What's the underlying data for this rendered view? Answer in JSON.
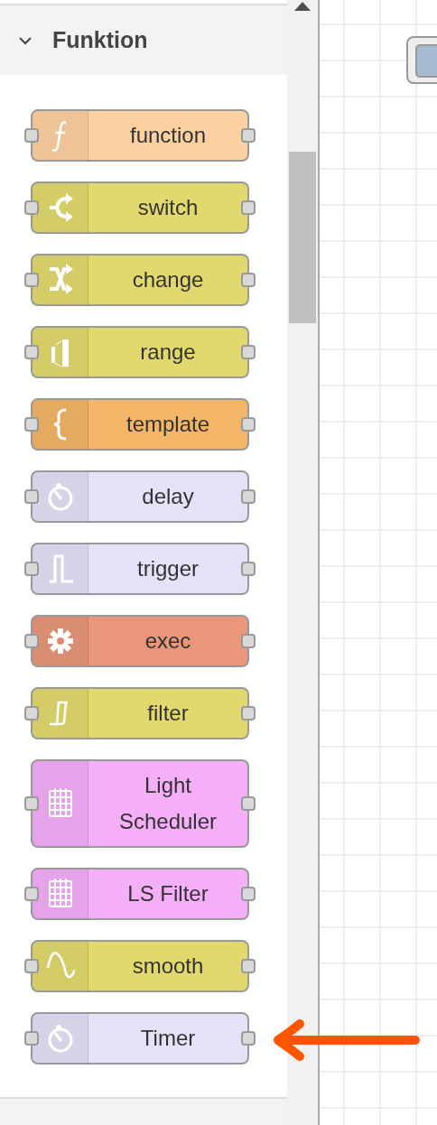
{
  "palette": {
    "category": {
      "title": "Funktion",
      "expanded": true
    },
    "nodes": [
      {
        "label": "function",
        "kind": "function",
        "color": "#fdd0a2"
      },
      {
        "label": "switch",
        "kind": "switch",
        "color": "#e2d96e"
      },
      {
        "label": "change",
        "kind": "change",
        "color": "#e2d96e"
      },
      {
        "label": "range",
        "kind": "range",
        "color": "#e2d96e"
      },
      {
        "label": "template",
        "kind": "template",
        "color": "#f3b567"
      },
      {
        "label": "delay",
        "kind": "timer",
        "color": "#e6e0f8"
      },
      {
        "label": "trigger",
        "kind": "trigger",
        "color": "#e6e0f8"
      },
      {
        "label": "exec",
        "kind": "gear",
        "color": "#e9967a"
      },
      {
        "label": "filter",
        "kind": "filter",
        "color": "#e2d96e"
      },
      {
        "label": "Light Scheduler",
        "kind": "calendar",
        "color": "#f5aef8"
      },
      {
        "label": "LS Filter",
        "kind": "calendar",
        "color": "#f5aef8"
      },
      {
        "label": "smooth",
        "kind": "wave",
        "color": "#e2d96e"
      },
      {
        "label": "Timer",
        "kind": "timer",
        "color": "#e6e0f8"
      }
    ]
  }
}
